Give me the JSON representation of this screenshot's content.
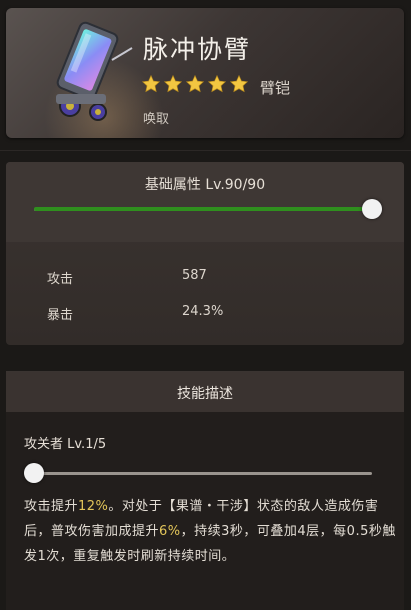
{
  "item": {
    "name": "脉冲协臂",
    "rarity_stars": 5,
    "slot": "臂铠",
    "source": "唤取"
  },
  "base_attributes": {
    "title": "基础属性 Lv.90/90",
    "level_current": 90,
    "level_max": 90,
    "stats": [
      {
        "label": "攻击",
        "value": "587"
      },
      {
        "label": "暴击",
        "value": "24.3%"
      }
    ]
  },
  "skill": {
    "section_title": "技能描述",
    "name_level": "攻关者 Lv.1/5",
    "level_current": 1,
    "level_max": 5,
    "desc_part1": "攻击提升",
    "desc_hl1": "12%",
    "desc_part2": "。对处于【果谱・干涉】状态的敌人造成伤害后，普攻伤害加成提升",
    "desc_hl2": "6%",
    "desc_part3": "，持续3秒，可叠加4层，每0.5秒触发1次，重复触发时刷新持续时间。"
  },
  "colors": {
    "star": "#f2c641",
    "level_fill": "#2f8f1e",
    "highlight": "#e3c65a"
  },
  "icons": [
    "pulse-arm-item-icon",
    "star-icon",
    "slider-knob"
  ]
}
